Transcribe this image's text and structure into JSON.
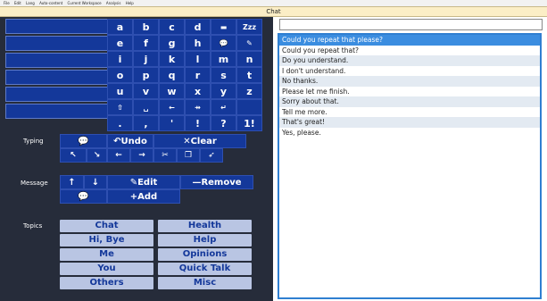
{
  "menubar": [
    "File",
    "Edit",
    "Lang",
    "Auto-content",
    "Current Workspace",
    "Analysis",
    "Help"
  ],
  "window_title": "Chat",
  "keyboard": {
    "rows": [
      [
        "a",
        "b",
        "c",
        "d",
        "▬",
        "Zzz"
      ],
      [
        "e",
        "f",
        "g",
        "h",
        "💬",
        "✎"
      ],
      [
        "i",
        "j",
        "k",
        "l",
        "m",
        "n"
      ],
      [
        "o",
        "p",
        "q",
        "r",
        "s",
        "t"
      ],
      [
        "u",
        "v",
        "w",
        "x",
        "y",
        "z"
      ],
      [
        "⇧",
        "␣",
        "←",
        "⇸",
        "↵",
        ""
      ],
      [
        ".",
        ",",
        "'",
        "!",
        "?",
        "1!"
      ]
    ]
  },
  "typing": {
    "label": "Typing",
    "speak": "💬",
    "undo": "↶Undo",
    "clear": "✕Clear",
    "tools": [
      "↖",
      "↘",
      "←",
      "→",
      "✂",
      "❐",
      "➶"
    ]
  },
  "message": {
    "label": "Message",
    "up": "↑",
    "down": "↓",
    "edit": "✎Edit",
    "remove": "—Remove",
    "speak": "💬",
    "add": "+Add"
  },
  "topics": {
    "label": "Topics",
    "items": [
      "Chat",
      "Health",
      "Hi, Bye",
      "Help",
      "Me",
      "Opinions",
      "You",
      "Quick Talk",
      "Others",
      "Misc"
    ]
  },
  "text_field": {
    "value": ""
  },
  "phrases": [
    "Could you repeat that please?",
    "Could you repeat that?",
    "Do you understand.",
    "I don't understand.",
    "No thanks.",
    "Please let me finish.",
    "Sorry about that.",
    "Tell me more.",
    "That's great!",
    "Yes, please."
  ],
  "colors": {
    "panel_bg": "#262c3a",
    "key_bg": "#14389a",
    "topic_bg": "#b9c5e3",
    "selection": "#3b8de0",
    "title_bar": "#fbeec6"
  }
}
